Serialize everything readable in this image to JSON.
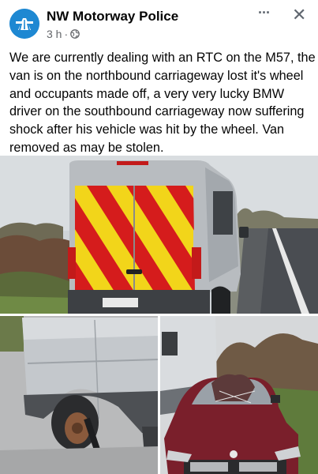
{
  "post": {
    "page_name": "NW Motorway Police",
    "time": "3 h",
    "time_sep": "·",
    "privacy_icon": "globe-icon",
    "more_icon": "more-dots-icon",
    "more_label": "···",
    "close_icon": "close-icon",
    "close_label": "✕",
    "text": "We are currently dealing with an RTC on the M57, the van is on the northbound carriageway lost it's wheel and occupants made off, a very very lucky BMW driver on the southbound carriageway now suffering shock after his vehicle was hit by the wheel. Van removed as may be stolen."
  },
  "photos": {
    "main": "van-rear-on-hard-shoulder",
    "bottom_left": "van-missing-wheel",
    "bottom_right": "bmw-damaged-windscreen"
  },
  "colors": {
    "brand_blue": "#1e88d2",
    "chevron_red": "#d51c1c",
    "chevron_yellow": "#f2d51a",
    "car_maroon": "#7a1f2b"
  }
}
